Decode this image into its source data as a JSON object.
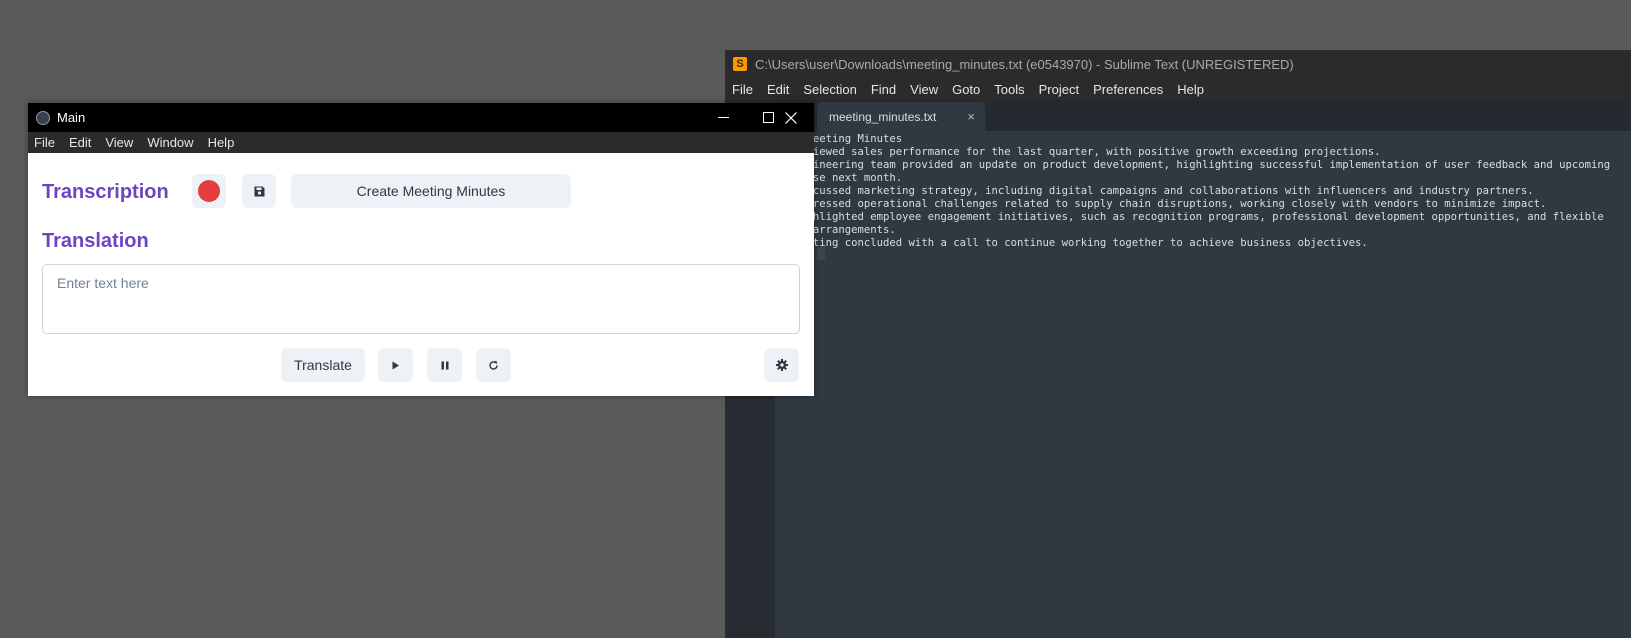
{
  "sublime": {
    "title": "C:\\Users\\user\\Downloads\\meeting_minutes.txt (e0543970) - Sublime Text (UNREGISTERED)",
    "menu": [
      "File",
      "Edit",
      "Selection",
      "Find",
      "View",
      "Goto",
      "Tools",
      "Project",
      "Preferences",
      "Help"
    ],
    "tab": {
      "label": "meeting_minutes.txt",
      "close": "×"
    },
    "content": "### Meeting Minutes\n- Reviewed sales performance for the last quarter, with positive growth exceeding projections.\n- Engineering team provided an update on product development, highlighting successful implementation of user feedback and upcoming release next month.\n- Discussed marketing strategy, including digital campaigns and collaborations with influencers and industry partners.\n- Addressed operational challenges related to supply chain disruptions, working closely with vendors to minimize impact.\n- Highlighted employee engagement initiatives, such as recognition programs, professional development opportunities, and flexible work arrangements.\n- Meeting concluded with a call to continue working together to achieve business objectives."
  },
  "main": {
    "title": "Main",
    "menu": [
      "File",
      "Edit",
      "View",
      "Window",
      "Help"
    ],
    "transcription_heading": "Transcription",
    "create_minutes_label": "Create Meeting Minutes",
    "translation_heading": "Translation",
    "input_placeholder": "Enter text here",
    "translate_label": "Translate",
    "colors": {
      "accent": "#6b46c1",
      "record": "#e53e3e",
      "button_bg": "#edf2f7"
    }
  }
}
